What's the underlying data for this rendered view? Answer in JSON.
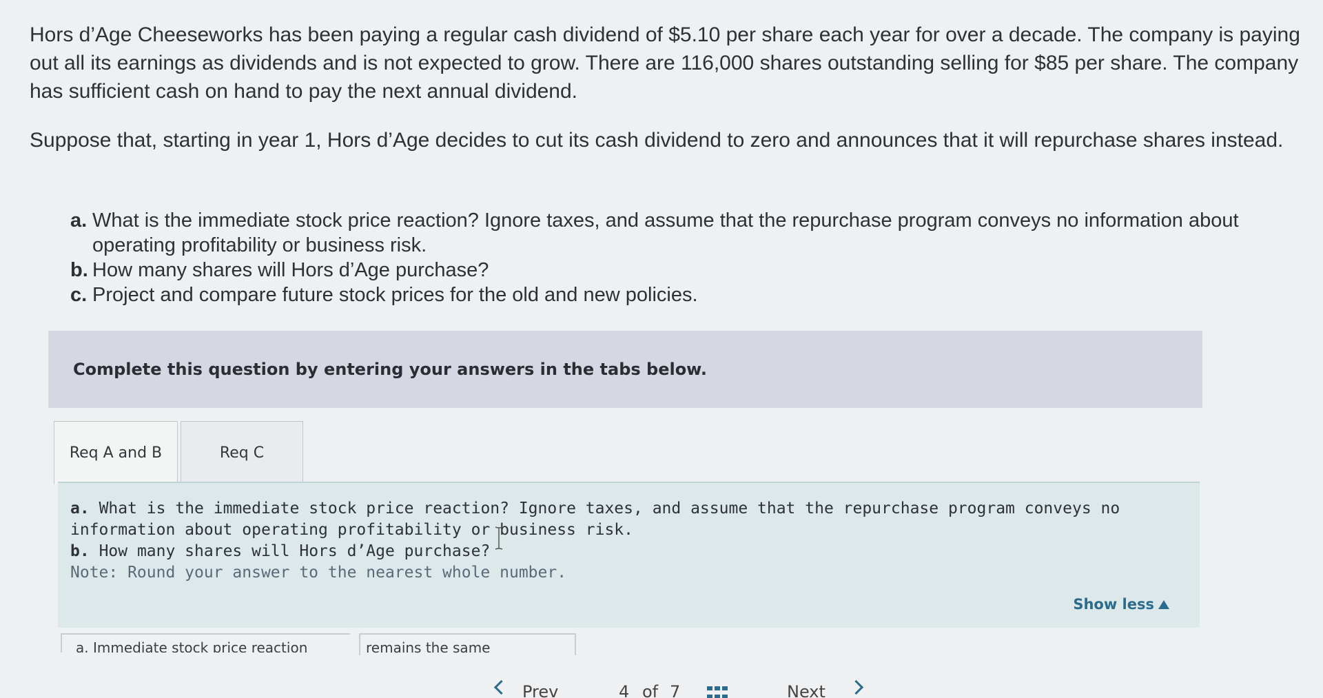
{
  "intro": {
    "paragraph1": "Hors d’Age Cheeseworks has been paying a regular cash dividend of $5.10 per share each year for over a decade. The company is paying out all its earnings as dividends and is not expected to grow. There are 116,000 shares outstanding selling for $85 per share. The company has sufficient cash on hand to pay the next annual dividend.",
    "paragraph2": "Suppose that, starting in year 1, Hors d’Age decides to cut its cash dividend to zero and announces that it will repurchase shares instead."
  },
  "questions": [
    {
      "letter": "a.",
      "text": "What is the immediate stock price reaction? Ignore taxes, and assume that the repurchase program conveys no information about operating profitability or business risk."
    },
    {
      "letter": "b.",
      "text": "How many shares will Hors d’Age purchase?"
    },
    {
      "letter": "c.",
      "text": "Project and compare future stock prices for the old and new policies."
    }
  ],
  "instruction": "Complete this question by entering your answers in the tabs below.",
  "tabs": [
    {
      "label": "Req A and B",
      "active": true
    },
    {
      "label": "Req C",
      "active": false
    }
  ],
  "panel": {
    "line_a_letter": "a.",
    "line_a": "What is the immediate stock price reaction? Ignore taxes, and assume that the repurchase program conveys no",
    "line_a2": "information about operating profitability or business risk.",
    "line_b_letter": "b.",
    "line_b": "How many shares will Hors d’Age purchase?",
    "note": "Note: Round your answer to the nearest whole number.",
    "show_less": "Show less"
  },
  "answer": {
    "label": "a. Immediate stock price reaction",
    "value": "remains the same"
  },
  "pager": {
    "prev": "Prev",
    "current": "4",
    "of": "of",
    "total": "7",
    "next": "Next"
  },
  "colors": {
    "accent": "#2b6c8c",
    "instruction_bar": "#d5d8e2",
    "panel_bg": "#dce8ea"
  }
}
